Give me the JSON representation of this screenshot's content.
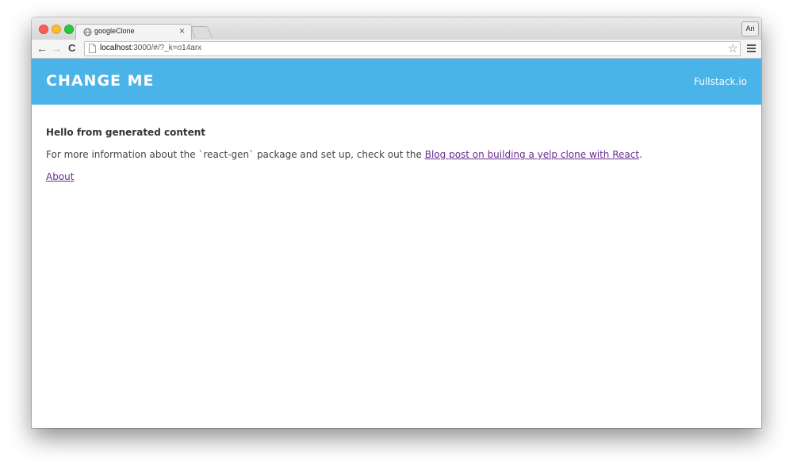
{
  "browser": {
    "tab_title": "googleClone",
    "tab_close": "×",
    "profile_label": "Ari",
    "url_host": "localhost",
    "url_path": ":3000/#/?_k=o14arx",
    "nav": {
      "back": "←",
      "forward": "→",
      "reload": "C"
    },
    "star": "☆"
  },
  "header": {
    "title": "CHANGE ME",
    "link": "Fullstack.io",
    "color": "#4ab3e8"
  },
  "main": {
    "heading": "Hello from generated content",
    "info_prefix": "For more information about the `react-gen` package and set up, check out the ",
    "info_link": "Blog post on building a yelp clone with React",
    "info_suffix": ".",
    "about_link": "About",
    "link_color": "#6a2c91"
  }
}
